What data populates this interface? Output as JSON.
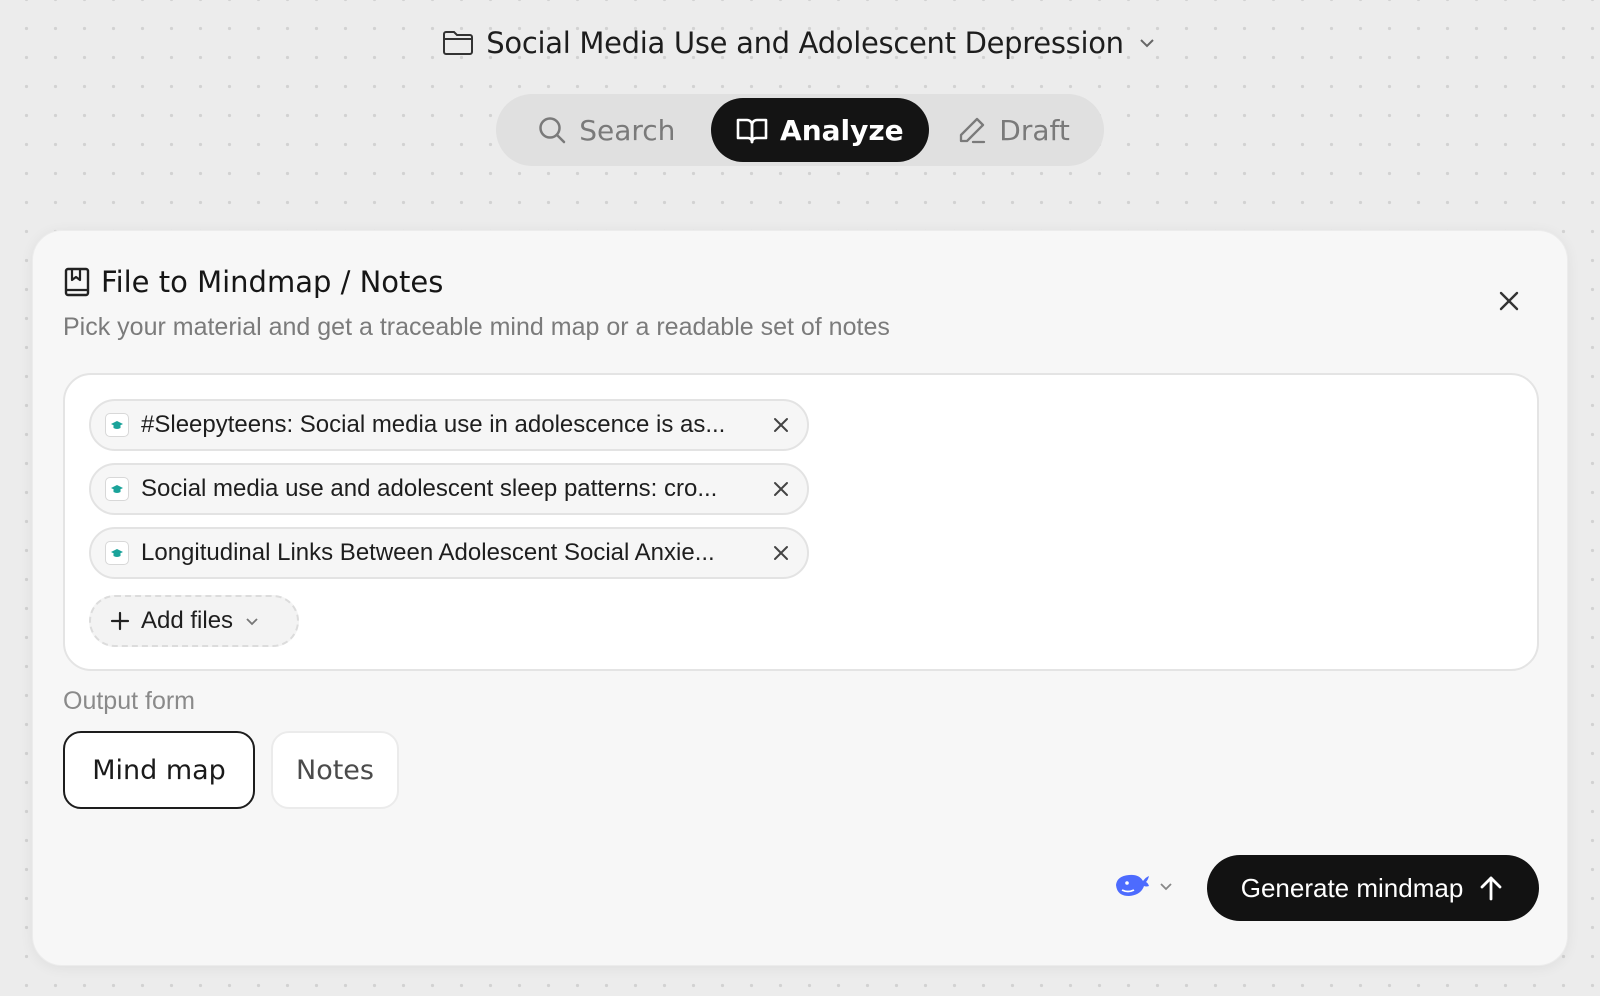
{
  "project": {
    "title": "Social Media Use and Adolescent Depression",
    "folder_icon": "folder-icon",
    "dropdown_icon": "chevron-down-icon"
  },
  "modes": {
    "tabs": [
      {
        "label": "Search",
        "icon": "search-icon",
        "active": false
      },
      {
        "label": "Analyze",
        "icon": "book-open-icon",
        "active": true
      },
      {
        "label": "Draft",
        "icon": "pencil-icon",
        "active": false
      }
    ]
  },
  "panel": {
    "title": "File to Mindmap / Notes",
    "subtitle": "Pick your material and get a traceable mind map or a readable set of notes",
    "title_icon": "bookmark-book-icon",
    "close_icon": "close-icon"
  },
  "files": [
    {
      "name": "#Sleepyteens: Social media use in adolescence is as...",
      "icon": "scholar-cap-icon"
    },
    {
      "name": "Social media use and adolescent sleep patterns: cro...",
      "icon": "scholar-cap-icon"
    },
    {
      "name": "Longitudinal Links Between Adolescent Social Anxie...",
      "icon": "scholar-cap-icon"
    }
  ],
  "add_files": {
    "label": "Add files"
  },
  "output": {
    "label": "Output form",
    "options": [
      {
        "label": "Mind map",
        "selected": true
      },
      {
        "label": "Notes",
        "selected": false
      }
    ]
  },
  "model": {
    "icon": "whale-icon",
    "color": "#4d6bfe"
  },
  "generate": {
    "label": "Generate mindmap",
    "icon": "arrow-up-icon"
  },
  "colors": {
    "accent_dark": "#141414",
    "chip_icon": "#1aa39a"
  }
}
